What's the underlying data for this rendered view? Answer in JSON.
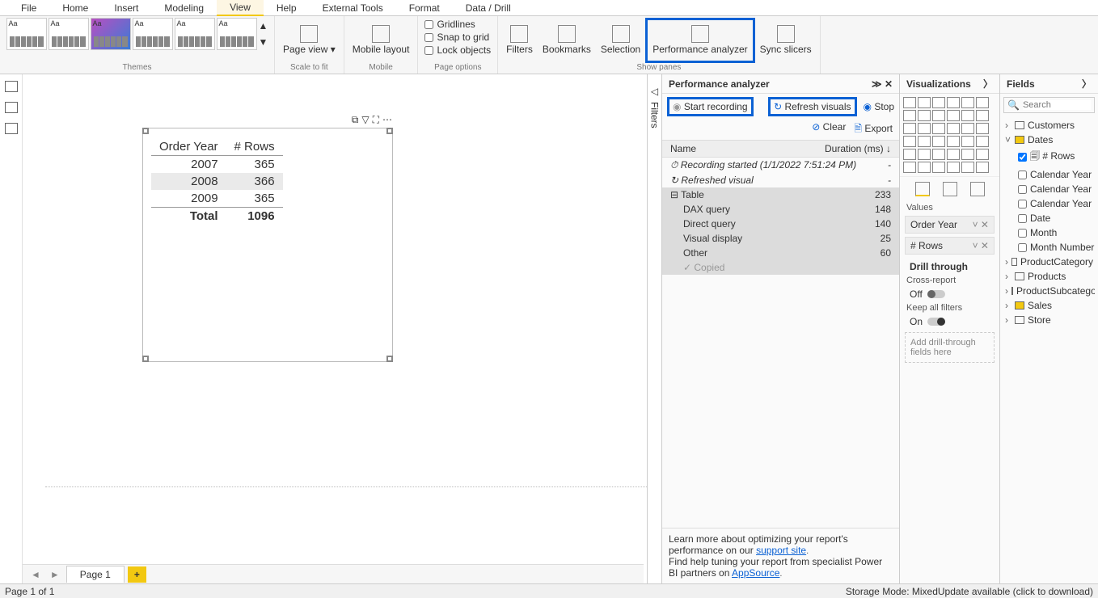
{
  "menubar": {
    "file": "File",
    "home": "Home",
    "insert": "Insert",
    "modeling": "Modeling",
    "view": "View",
    "help": "Help",
    "external": "External Tools",
    "format": "Format",
    "data": "Data / Drill"
  },
  "ribbon": {
    "themes_label": "Themes",
    "scale_label": "Scale to fit",
    "page_view": "Page view ▾",
    "mobile_label": "Mobile",
    "mobile_layout": "Mobile layout",
    "pageopts_label": "Page options",
    "gridlines": "Gridlines",
    "snap": "Snap to grid",
    "lock": "Lock objects",
    "show_label": "Show panes",
    "filters": "Filters",
    "bookmarks": "Bookmarks",
    "selection": "Selection",
    "perf": "Performance analyzer",
    "sync": "Sync slicers"
  },
  "canvas": {
    "table": {
      "col1": "Order Year",
      "col2": "# Rows",
      "rows": [
        {
          "y": "2007",
          "n": "365"
        },
        {
          "y": "2008",
          "n": "366"
        },
        {
          "y": "2009",
          "n": "365"
        }
      ],
      "total_l": "Total",
      "total_v": "1096"
    },
    "page_tab": "Page 1",
    "add": "+"
  },
  "filters_label": "Filters",
  "perf": {
    "title": "Performance analyzer",
    "start": "Start recording",
    "refresh": "Refresh visuals",
    "stop": "Stop",
    "clear": "Clear",
    "export": "Export",
    "hdr_name": "Name",
    "hdr_dur": "Duration (ms) ↓",
    "rows": [
      {
        "n": "Recording started (1/1/2022 7:51:24 PM)",
        "d": "-",
        "ital": true,
        "icon": "⏱"
      },
      {
        "n": "Refreshed visual",
        "d": "-",
        "ital": true,
        "icon": "↻"
      },
      {
        "n": "Table",
        "d": "233",
        "sel": true,
        "exp": true
      },
      {
        "n": "DAX query",
        "d": "148",
        "sel": true,
        "ind": true
      },
      {
        "n": "Direct query",
        "d": "140",
        "sel": true,
        "ind": true
      },
      {
        "n": "Visual display",
        "d": "25",
        "sel": true,
        "ind": true
      },
      {
        "n": "Other",
        "d": "60",
        "sel": true,
        "ind": true
      },
      {
        "n": "✓ Copied",
        "d": "",
        "sel": true,
        "ind": true,
        "grey": true
      }
    ],
    "foot1": "Learn more about optimizing your report's performance on our ",
    "foot1l": "support site",
    "foot2": "Find help tuning your report from specialist Power BI partners on ",
    "foot2l": "AppSource"
  },
  "viz": {
    "title": "Visualizations",
    "values": "Values",
    "v1": "Order Year",
    "v2": "# Rows",
    "drill": "Drill through",
    "cross": "Cross-report",
    "off": "Off",
    "keep": "Keep all filters",
    "on": "On",
    "drop": "Add drill-through fields here"
  },
  "fields": {
    "title": "Fields",
    "search": "Search",
    "tables": [
      "Customers",
      "Dates",
      "ProductCategory",
      "Products",
      "ProductSubcategory",
      "Sales",
      "Store"
    ],
    "dates_children": [
      "# Rows",
      "Calendar Year",
      "Calendar Year M...",
      "Calendar Year N...",
      "Date",
      "Month",
      "Month Number"
    ]
  },
  "status": {
    "left": "Page 1 of 1",
    "right": "Storage Mode: MixedUpdate available (click to download)"
  }
}
